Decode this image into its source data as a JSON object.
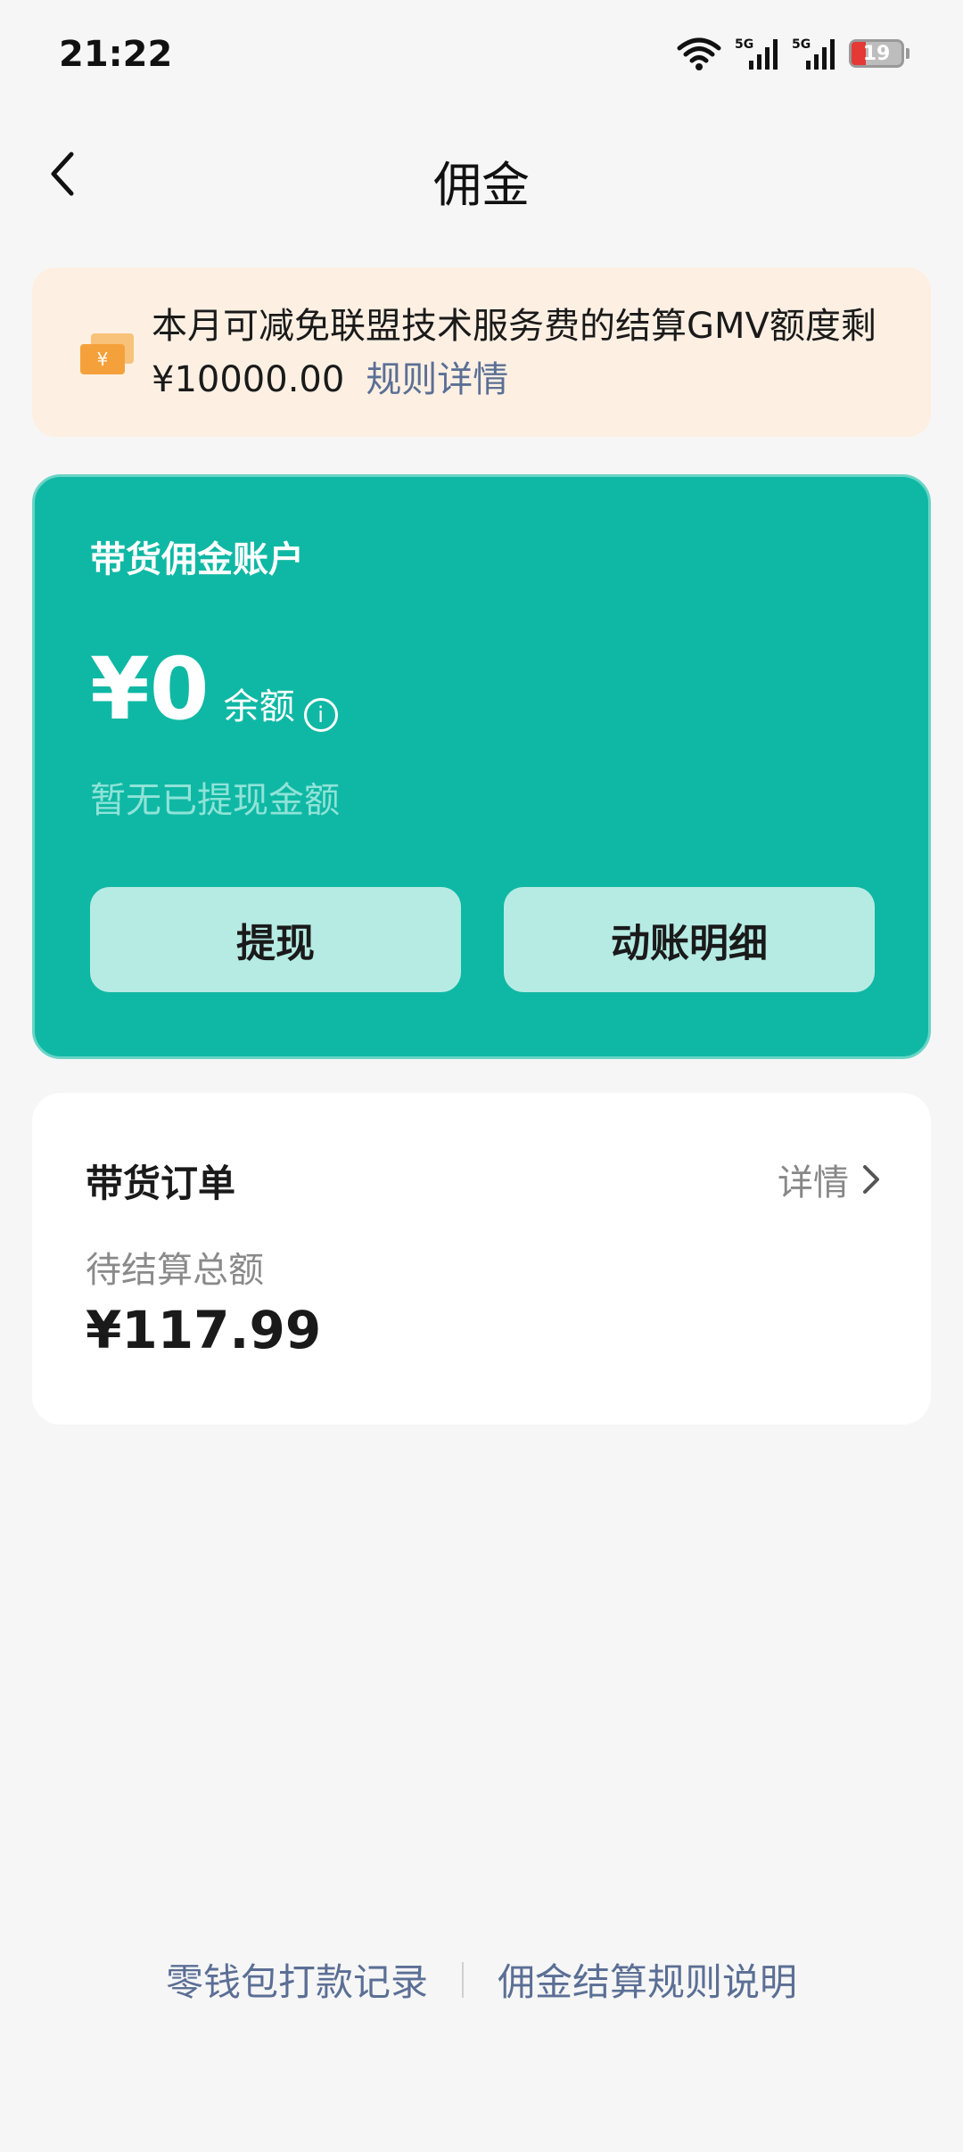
{
  "status_bar": {
    "time": "21:22",
    "battery_level": "19",
    "icons": [
      "wifi-icon",
      "signal-5g-icon",
      "signal-5g-icon",
      "battery-icon"
    ]
  },
  "header": {
    "title": "佣金",
    "back_icon": "chevron-left-icon"
  },
  "notice": {
    "icon": "money-stack-icon",
    "text": "本月可减免联盟技术服务费的结算GMV额度剩 ¥10000.00",
    "link_label": "规则详情",
    "accent_color": "#f5a13b"
  },
  "account": {
    "title": "带货佣金账户",
    "balance": "¥0",
    "balance_label": "余额",
    "info_icon": "info-icon",
    "withdrawn_text": "暂无已提现金额",
    "withdraw_button": "提现",
    "detail_button": "动账明细",
    "card_color": "#0fb8a4",
    "button_color": "#b6ebe4"
  },
  "orders": {
    "title": "带货订单",
    "detail_label": "详情",
    "pending_label": "待结算总额",
    "pending_amount": "¥117.99"
  },
  "footer": {
    "link_wallet_records": "零钱包打款记录",
    "link_rules": "佣金结算规则说明",
    "link_color": "#5b6f95"
  }
}
